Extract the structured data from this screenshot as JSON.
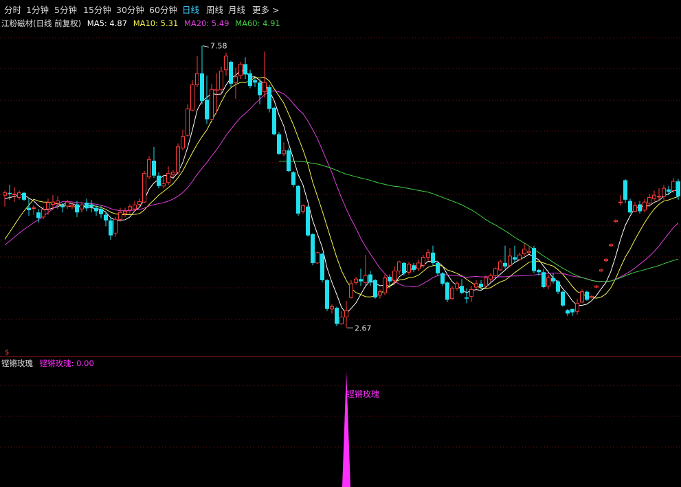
{
  "toolbar": {
    "periods": [
      {
        "label": "分时",
        "active": false
      },
      {
        "label": "1分钟",
        "active": false
      },
      {
        "label": "5分钟",
        "active": false
      },
      {
        "label": "15分钟",
        "active": false
      },
      {
        "label": "30分钟",
        "active": false
      },
      {
        "label": "60分钟",
        "active": false
      },
      {
        "label": "日线",
        "active": true
      },
      {
        "label": "周线",
        "active": false
      },
      {
        "label": "月线",
        "active": false
      },
      {
        "label": "更多 >",
        "active": false
      }
    ]
  },
  "legend": {
    "title": "江粉磁材(日线 前复权)",
    "ma5": "MA5: 4.87",
    "ma10": "MA10: 5.31",
    "ma20": "MA20: 5.49",
    "ma60": "MA60: 4.91"
  },
  "indicator": {
    "name": "铿锵玫瑰",
    "value_label": "铿锵玫瑰: 0.00",
    "spike_label": "铿锵玫瑰",
    "marker": "$"
  },
  "colors": {
    "up": "#ff3c3c",
    "down": "#20e0ee",
    "ma5": "#ffffff",
    "ma10": "#f5f550",
    "ma20": "#e040e0",
    "ma60": "#40d040",
    "spike": "#ff30ff",
    "grid": "#7a1010",
    "active_tab": "#3fd0ff"
  },
  "chart_data": {
    "type": "candlestick",
    "title": "江粉磁材(日线 前复权)",
    "ylim": [
      2.4,
      7.85
    ],
    "annotations": [
      {
        "text": "7.58",
        "kind": "high",
        "value": 7.58
      },
      {
        "text": "2.67",
        "kind": "low",
        "value": 2.67
      }
    ],
    "candles": [
      [
        4.98,
        5.02,
        4.78,
        5.06
      ],
      [
        5.02,
        5.0,
        4.9,
        5.16
      ],
      [
        5.0,
        5.0,
        4.86,
        5.12
      ],
      [
        4.94,
        5.02,
        4.9,
        5.06
      ],
      [
        5.02,
        4.9,
        4.88,
        5.04
      ],
      [
        4.76,
        4.72,
        4.62,
        4.92
      ],
      [
        4.75,
        4.76,
        4.64,
        4.8
      ],
      [
        4.68,
        4.58,
        4.5,
        4.74
      ],
      [
        4.6,
        4.73,
        4.56,
        4.78
      ],
      [
        4.74,
        4.85,
        4.64,
        4.92
      ],
      [
        4.82,
        4.86,
        4.72,
        4.98
      ],
      [
        4.84,
        4.88,
        4.74,
        4.96
      ],
      [
        4.8,
        4.77,
        4.68,
        4.84
      ],
      [
        4.79,
        4.86,
        4.74,
        4.9
      ],
      [
        4.78,
        4.8,
        4.74,
        4.84
      ],
      [
        4.82,
        4.68,
        4.6,
        4.88
      ],
      [
        4.74,
        4.81,
        4.68,
        4.86
      ],
      [
        4.85,
        4.75,
        4.7,
        4.92
      ],
      [
        4.82,
        4.77,
        4.68,
        4.9
      ],
      [
        4.76,
        4.7,
        4.62,
        4.8
      ],
      [
        4.74,
        4.65,
        4.58,
        4.8
      ],
      [
        4.64,
        4.54,
        4.44,
        4.7
      ],
      [
        4.54,
        4.28,
        4.2,
        4.6
      ],
      [
        4.32,
        4.56,
        4.26,
        4.6
      ],
      [
        4.56,
        4.68,
        4.52,
        4.76
      ],
      [
        4.66,
        4.7,
        4.6,
        4.76
      ],
      [
        4.72,
        4.78,
        4.64,
        4.82
      ],
      [
        4.74,
        4.81,
        4.7,
        4.88
      ],
      [
        4.82,
        4.87,
        4.76,
        4.92
      ],
      [
        4.86,
        5.36,
        4.84,
        5.4
      ],
      [
        5.3,
        5.6,
        5.26,
        5.66
      ],
      [
        5.58,
        5.32,
        5.28,
        5.82
      ],
      [
        5.32,
        5.14,
        5.1,
        5.38
      ],
      [
        5.14,
        5.18,
        5.1,
        5.34
      ],
      [
        5.2,
        5.36,
        5.16,
        5.48
      ],
      [
        5.34,
        5.38,
        5.28,
        5.42
      ],
      [
        5.38,
        5.82,
        5.34,
        5.88
      ],
      [
        5.8,
        6.0,
        5.76,
        6.12
      ],
      [
        6.02,
        6.48,
        6.0,
        6.56
      ],
      [
        6.46,
        6.9,
        6.44,
        6.98
      ],
      [
        6.9,
        7.1,
        6.86,
        7.4
      ],
      [
        7.1,
        6.62,
        6.56,
        7.58
      ],
      [
        6.64,
        6.3,
        6.22,
        7.06
      ],
      [
        6.3,
        6.82,
        6.24,
        6.92
      ],
      [
        6.8,
        6.82,
        6.4,
        7.1
      ],
      [
        6.82,
        7.14,
        6.74,
        7.22
      ],
      [
        7.16,
        7.4,
        7.06,
        7.46
      ],
      [
        7.3,
        6.92,
        6.86,
        7.32
      ],
      [
        6.94,
        7.04,
        6.66,
        7.2
      ],
      [
        7.06,
        7.26,
        7.0,
        7.3
      ],
      [
        7.26,
        7.08,
        7.0,
        7.38
      ],
      [
        7.1,
        6.88,
        6.84,
        7.16
      ],
      [
        6.98,
        6.94,
        6.86,
        7.02
      ],
      [
        6.94,
        6.72,
        6.56,
        7.0
      ],
      [
        6.78,
        6.94,
        6.68,
        7.48
      ],
      [
        6.86,
        6.48,
        6.42,
        6.9
      ],
      [
        6.5,
        6.04,
        6.02,
        6.52
      ],
      [
        6.04,
        5.7,
        5.68,
        6.08
      ],
      [
        5.7,
        5.76,
        5.66,
        5.9
      ],
      [
        5.76,
        5.4,
        5.38,
        5.8
      ],
      [
        5.38,
        5.16,
        5.12,
        5.4
      ],
      [
        5.14,
        4.66,
        4.62,
        5.16
      ],
      [
        4.7,
        4.8,
        4.66,
        4.82
      ],
      [
        4.78,
        4.28,
        4.26,
        4.8
      ],
      [
        4.3,
        3.8,
        3.76,
        4.32
      ],
      [
        3.8,
        3.98,
        3.78,
        4.0
      ],
      [
        3.96,
        3.5,
        3.46,
        3.98
      ],
      [
        3.5,
        3.0,
        2.96,
        3.52
      ],
      [
        3.0,
        3.04,
        2.92,
        3.08
      ],
      [
        3.02,
        2.74,
        2.7,
        3.04
      ],
      [
        2.74,
        2.86,
        2.72,
        2.96
      ],
      [
        2.86,
        2.97,
        2.67,
        3.14
      ],
      [
        3.2,
        3.44,
        3.18,
        3.5
      ],
      [
        3.46,
        3.52,
        3.42,
        3.56
      ],
      [
        3.52,
        3.48,
        3.4,
        3.7
      ],
      [
        3.46,
        3.58,
        3.4,
        3.94
      ],
      [
        3.6,
        3.46,
        3.4,
        3.66
      ],
      [
        3.5,
        3.2,
        3.18,
        3.52
      ],
      [
        3.24,
        3.3,
        3.18,
        3.34
      ],
      [
        3.28,
        3.54,
        3.24,
        3.6
      ],
      [
        3.56,
        3.48,
        3.36,
        3.6
      ],
      [
        3.5,
        3.66,
        3.44,
        3.74
      ],
      [
        3.66,
        3.82,
        3.6,
        3.84
      ],
      [
        3.8,
        3.62,
        3.58,
        3.82
      ],
      [
        3.64,
        3.78,
        3.6,
        3.82
      ],
      [
        3.76,
        3.68,
        3.64,
        3.8
      ],
      [
        3.7,
        3.8,
        3.66,
        3.86
      ],
      [
        3.76,
        3.9,
        3.72,
        3.94
      ],
      [
        3.9,
        3.98,
        3.84,
        4.04
      ],
      [
        3.98,
        3.8,
        3.76,
        4.1
      ],
      [
        3.8,
        3.62,
        3.58,
        3.84
      ],
      [
        3.62,
        3.44,
        3.4,
        3.64
      ],
      [
        3.46,
        3.16,
        3.12,
        3.48
      ],
      [
        3.18,
        3.36,
        3.16,
        3.4
      ],
      [
        3.36,
        3.44,
        3.32,
        3.48
      ],
      [
        3.4,
        3.28,
        3.26,
        3.52
      ],
      [
        3.2,
        3.18,
        3.1,
        3.36
      ],
      [
        3.22,
        3.34,
        3.12,
        3.4
      ],
      [
        3.38,
        3.44,
        3.34,
        3.5
      ],
      [
        3.44,
        3.38,
        3.34,
        3.5
      ],
      [
        3.4,
        3.54,
        3.36,
        3.58
      ],
      [
        3.52,
        3.58,
        3.46,
        3.62
      ],
      [
        3.58,
        3.7,
        3.54,
        3.72
      ],
      [
        3.68,
        3.82,
        3.66,
        3.86
      ],
      [
        3.8,
        3.74,
        3.7,
        4.1
      ],
      [
        3.76,
        3.92,
        3.72,
        4.06
      ],
      [
        3.9,
        3.86,
        3.82,
        4.1
      ],
      [
        3.86,
        3.94,
        3.84,
        3.98
      ],
      [
        3.96,
        4.04,
        3.92,
        4.14
      ],
      [
        3.98,
        4.0,
        3.96,
        4.08
      ],
      [
        4.06,
        3.66,
        3.62,
        4.1
      ],
      [
        3.68,
        3.64,
        3.58,
        3.7
      ],
      [
        3.64,
        3.38,
        3.36,
        3.7
      ],
      [
        3.4,
        3.54,
        3.34,
        3.6
      ],
      [
        3.54,
        3.48,
        3.44,
        3.62
      ],
      [
        3.48,
        3.3,
        3.26,
        3.5
      ],
      [
        3.3,
        3.06,
        3.04,
        3.32
      ],
      [
        2.98,
        2.92,
        2.88,
        3.0
      ],
      [
        3.0,
        2.94,
        2.88,
        3.0
      ],
      [
        2.96,
        3.1,
        2.9,
        3.18
      ],
      [
        3.12,
        3.3,
        3.1,
        3.34
      ],
      [
        3.3,
        3.16,
        3.14,
        3.32
      ],
      [
        3.2,
        3.22,
        3.18,
        3.24
      ],
      [
        3.38,
        3.4,
        3.36,
        3.42
      ],
      [
        3.66,
        3.68,
        3.64,
        3.7
      ],
      [
        3.84,
        3.86,
        3.82,
        3.88
      ],
      [
        4.1,
        4.12,
        4.08,
        4.14
      ],
      [
        4.52,
        4.54,
        4.5,
        4.56
      ],
      [
        4.86,
        4.86,
        4.8,
        4.98
      ],
      [
        5.24,
        4.9,
        4.84,
        5.26
      ],
      [
        4.88,
        4.68,
        4.66,
        4.92
      ],
      [
        4.7,
        4.8,
        4.68,
        4.86
      ],
      [
        4.82,
        4.7,
        4.66,
        4.88
      ],
      [
        4.72,
        4.86,
        4.68,
        4.92
      ],
      [
        4.84,
        4.94,
        4.78,
        5.0
      ],
      [
        4.92,
        4.98,
        4.88,
        5.06
      ],
      [
        4.96,
        4.96,
        4.88,
        5.1
      ],
      [
        4.96,
        5.1,
        4.9,
        5.16
      ],
      [
        5.08,
        5.04,
        4.98,
        5.14
      ],
      [
        5.06,
        5.22,
        5.02,
        5.28
      ],
      [
        5.22,
        4.96,
        4.9,
        5.26
      ]
    ],
    "ma_series": [
      {
        "name": "MA5",
        "period": 5,
        "color": "#ffffff"
      },
      {
        "name": "MA10",
        "period": 10,
        "color": "#f5f550"
      },
      {
        "name": "MA20",
        "period": 20,
        "color": "#e040e0"
      },
      {
        "name": "MA60",
        "period": 60,
        "color": "#40d040"
      }
    ],
    "indicator_values": [
      {
        "name": "铿锵玫瑰",
        "signal_bar": 71,
        "value": 0.0
      }
    ]
  }
}
